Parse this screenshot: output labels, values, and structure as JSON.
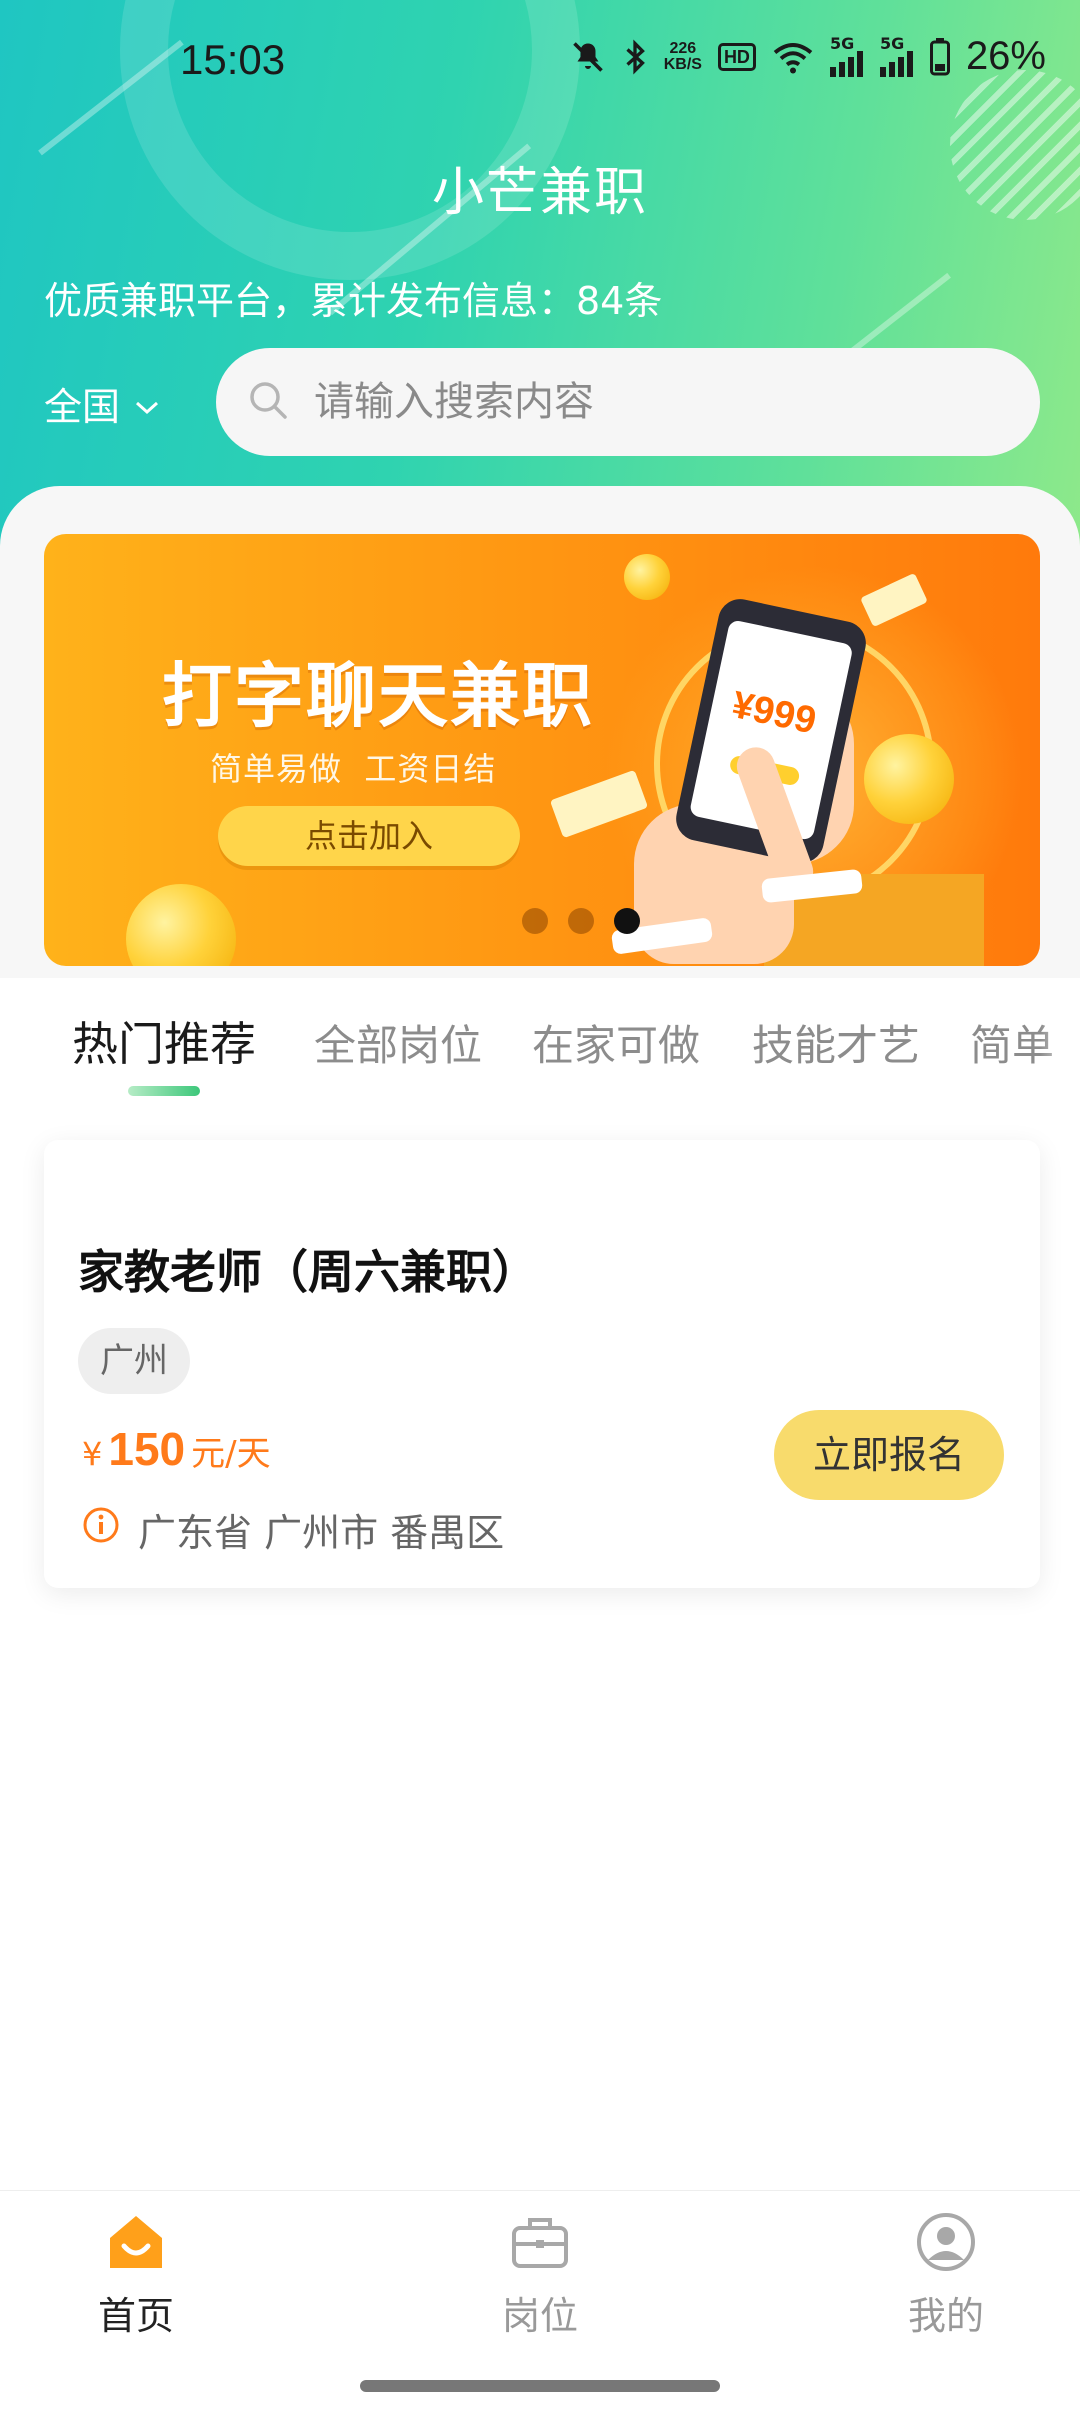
{
  "status_bar": {
    "time": "15:03",
    "net_speed_value": "226",
    "net_speed_unit": "KB/S",
    "hd_label": "HD",
    "signal1_label": "5G",
    "signal2_label": "5G",
    "battery": "26%"
  },
  "header": {
    "app_title": "小芒兼职",
    "subtitle": "优质兼职平台，累计发布信息：84条",
    "region": "全国",
    "search_placeholder": "请输入搜索内容"
  },
  "banner": {
    "headline": "打字聊天兼职",
    "subline": "简单易做  工资日结",
    "button": "点击加入",
    "phone_amount": "¥999",
    "dots_total": 3,
    "dots_active_index": 2
  },
  "tabs": [
    {
      "label": "热门推荐",
      "active": true
    },
    {
      "label": "全部岗位",
      "active": false
    },
    {
      "label": "在家可做",
      "active": false
    },
    {
      "label": "技能才艺",
      "active": false
    },
    {
      "label": "简单",
      "active": false
    }
  ],
  "job": {
    "title": "家教老师（周六兼职）",
    "tag": "广州",
    "salary_symbol": "¥",
    "salary_amount": "150",
    "salary_unit": "元/天",
    "location": "广东省 广州市 番禺区",
    "apply_label": "立即报名"
  },
  "bottom_nav": [
    {
      "label": "首页",
      "icon": "home-icon",
      "active": true
    },
    {
      "label": "岗位",
      "icon": "briefcase-icon",
      "active": false
    },
    {
      "label": "我的",
      "icon": "user-icon",
      "active": false
    }
  ],
  "colors": {
    "header_gradient_start": "#1fc6c2",
    "header_gradient_end": "#8ee98a",
    "accent_orange": "#ff7a1a",
    "apply_button": "#f8db6c",
    "home_active": "#ffa01a"
  }
}
